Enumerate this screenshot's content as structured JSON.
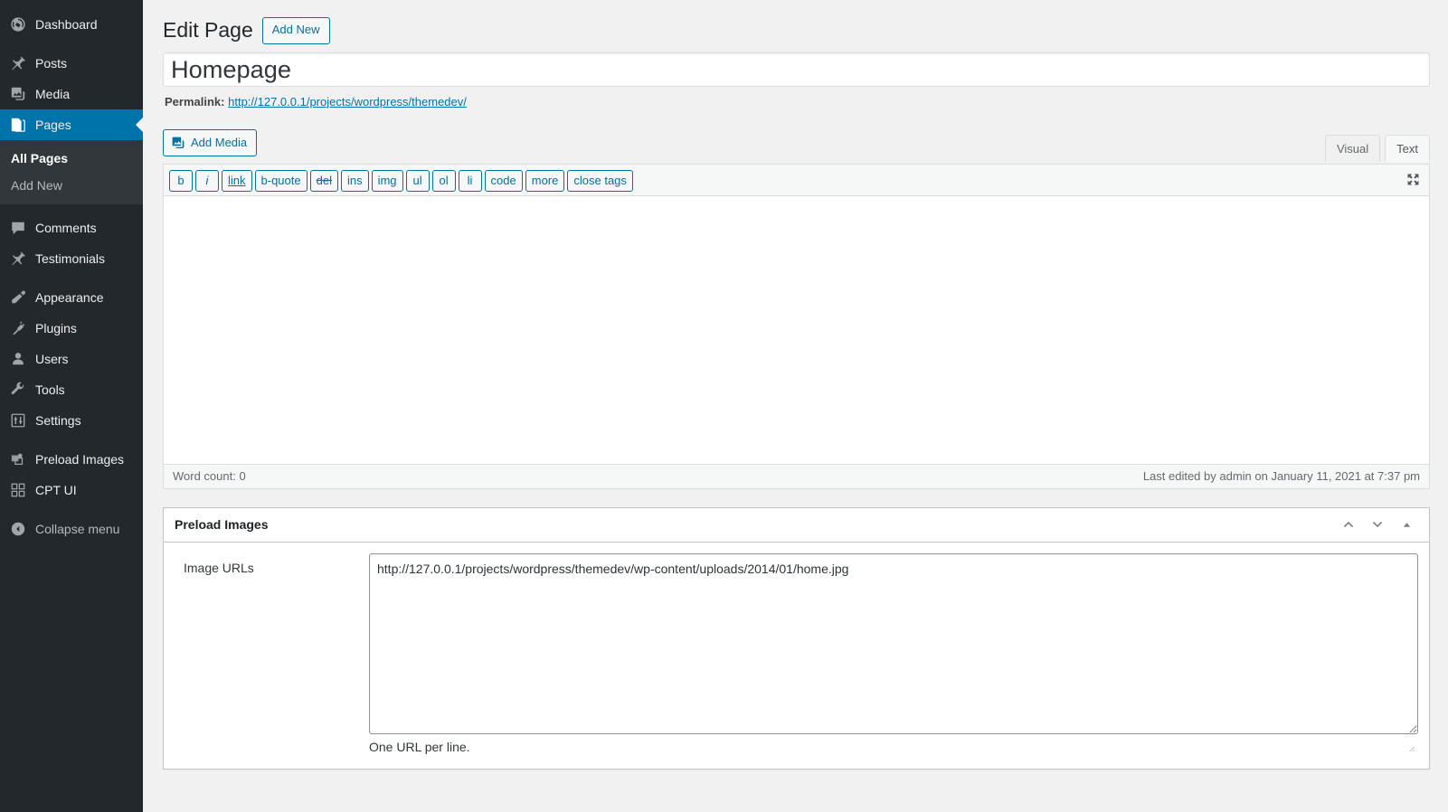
{
  "sidebar": {
    "items": [
      {
        "label": "Dashboard",
        "icon": "dashboard-icon",
        "name": "dashboard"
      },
      {
        "label": "Posts",
        "icon": "pin-icon",
        "name": "posts"
      },
      {
        "label": "Media",
        "icon": "media-icon",
        "name": "media"
      },
      {
        "label": "Pages",
        "icon": "pages-icon",
        "name": "pages",
        "current": true
      },
      {
        "label": "Comments",
        "icon": "comments-icon",
        "name": "comments"
      },
      {
        "label": "Testimonials",
        "icon": "pin-icon",
        "name": "testimonials"
      },
      {
        "label": "Appearance",
        "icon": "appearance-icon",
        "name": "appearance"
      },
      {
        "label": "Plugins",
        "icon": "plugins-icon",
        "name": "plugins"
      },
      {
        "label": "Users",
        "icon": "users-icon",
        "name": "users"
      },
      {
        "label": "Tools",
        "icon": "tools-icon",
        "name": "tools"
      },
      {
        "label": "Settings",
        "icon": "settings-icon",
        "name": "settings"
      },
      {
        "label": "Preload Images",
        "icon": "preload-images-icon",
        "name": "preload-images"
      },
      {
        "label": "CPT UI",
        "icon": "cpt-ui-icon",
        "name": "cpt-ui"
      }
    ],
    "submenu": [
      {
        "label": "All Pages",
        "current": true
      },
      {
        "label": "Add New",
        "current": false
      }
    ],
    "collapse": {
      "label": "Collapse menu",
      "icon": "collapse-arrow-icon"
    },
    "colors": {
      "background": "#23282d",
      "submenu_background": "#32373c",
      "current": "#0073aa",
      "text": "#eeeeee",
      "muted_text": "#b4b9be"
    }
  },
  "header": {
    "title": "Edit Page",
    "add_new_label": "Add New"
  },
  "post": {
    "title_value": "Homepage",
    "title_placeholder": "Enter title here",
    "permalink_label": "Permalink:",
    "permalink_url": "http://127.0.0.1/projects/wordpress/themedev/"
  },
  "editor": {
    "add_media_label": "Add Media",
    "add_media_icon": "media-icon",
    "fullscreen_icon": "fullscreen-icon",
    "tabs": [
      {
        "label": "Visual",
        "active": false
      },
      {
        "label": "Text",
        "active": true
      }
    ],
    "quicktags": [
      {
        "label": "b",
        "style": "bold",
        "name": "bold"
      },
      {
        "label": "i",
        "style": "italic",
        "name": "italic"
      },
      {
        "label": "link",
        "style": "link",
        "name": "link"
      },
      {
        "label": "b-quote",
        "style": "",
        "name": "blockquote"
      },
      {
        "label": "del",
        "style": "del",
        "name": "del"
      },
      {
        "label": "ins",
        "style": "",
        "name": "ins"
      },
      {
        "label": "img",
        "style": "",
        "name": "img"
      },
      {
        "label": "ul",
        "style": "",
        "name": "ul"
      },
      {
        "label": "ol",
        "style": "",
        "name": "ol"
      },
      {
        "label": "li",
        "style": "",
        "name": "li"
      },
      {
        "label": "code",
        "style": "",
        "name": "code"
      },
      {
        "label": "more",
        "style": "",
        "name": "more"
      },
      {
        "label": "close tags",
        "style": "",
        "name": "close-tags"
      }
    ],
    "content_value": "",
    "word_count_label": "Word count: 0",
    "last_edited": "Last edited by admin on January 11, 2021 at 7:37 pm"
  },
  "metabox": {
    "title": "Preload Images",
    "order_higher_icon": "chevron-up-icon",
    "order_lower_icon": "chevron-down-icon",
    "toggle_icon": "triangle-up-icon",
    "field_label": "Image URLs",
    "field_value": "http://127.0.0.1/projects/wordpress/themedev/wp-content/uploads/2014/01/home.jpg",
    "field_placeholder": "",
    "field_description": "One URL per line."
  }
}
